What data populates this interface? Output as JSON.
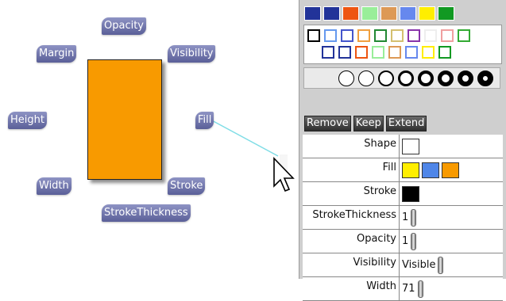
{
  "labels": {
    "opacity": "Opacity",
    "margin": "Margin",
    "visibility": "Visibility",
    "height": "Height",
    "fill": "Fill",
    "width": "Width",
    "stroke": "Stroke",
    "stroke_thickness": "StrokeThickness"
  },
  "shape": {
    "fill_color": "#f89a00"
  },
  "top_swatches": [
    "#223399",
    "#223399",
    "#ee5511",
    "#99ee99",
    "#dd9955",
    "#6688ee",
    "#ffee00",
    "#119922"
  ],
  "outline_rows": [
    [
      "#000000",
      "#6699ee",
      "#4455cc",
      "#f0a040",
      "#228833",
      "#d4c070",
      "#8833aa",
      "#eeeeee",
      "#f0a0a0",
      "#33aa33"
    ],
    [
      "#223399",
      "#223399",
      "#ee5511",
      "#99ee99",
      "#dd9955",
      "#6688ee",
      "#ffee00",
      "#119922"
    ]
  ],
  "stroke_thicknesses": [
    1,
    1,
    2,
    3,
    4,
    5,
    6,
    7
  ],
  "actions": {
    "remove": "Remove",
    "keep": "Keep",
    "extend": "Extend"
  },
  "properties": [
    {
      "name": "Shape",
      "kind": "swatch",
      "colors": [
        "#ffffff"
      ]
    },
    {
      "name": "Fill",
      "kind": "swatch",
      "colors": [
        "#ffee00",
        "#4f86e8",
        "#f89a00"
      ]
    },
    {
      "name": "Stroke",
      "kind": "swatch",
      "colors": [
        "#000000"
      ]
    },
    {
      "name": "StrokeThickness",
      "kind": "number",
      "value": "1"
    },
    {
      "name": "Opacity",
      "kind": "number",
      "value": "1"
    },
    {
      "name": "Visibility",
      "kind": "number",
      "value": "Visible"
    },
    {
      "name": "Width",
      "kind": "number",
      "value": "71"
    }
  ]
}
